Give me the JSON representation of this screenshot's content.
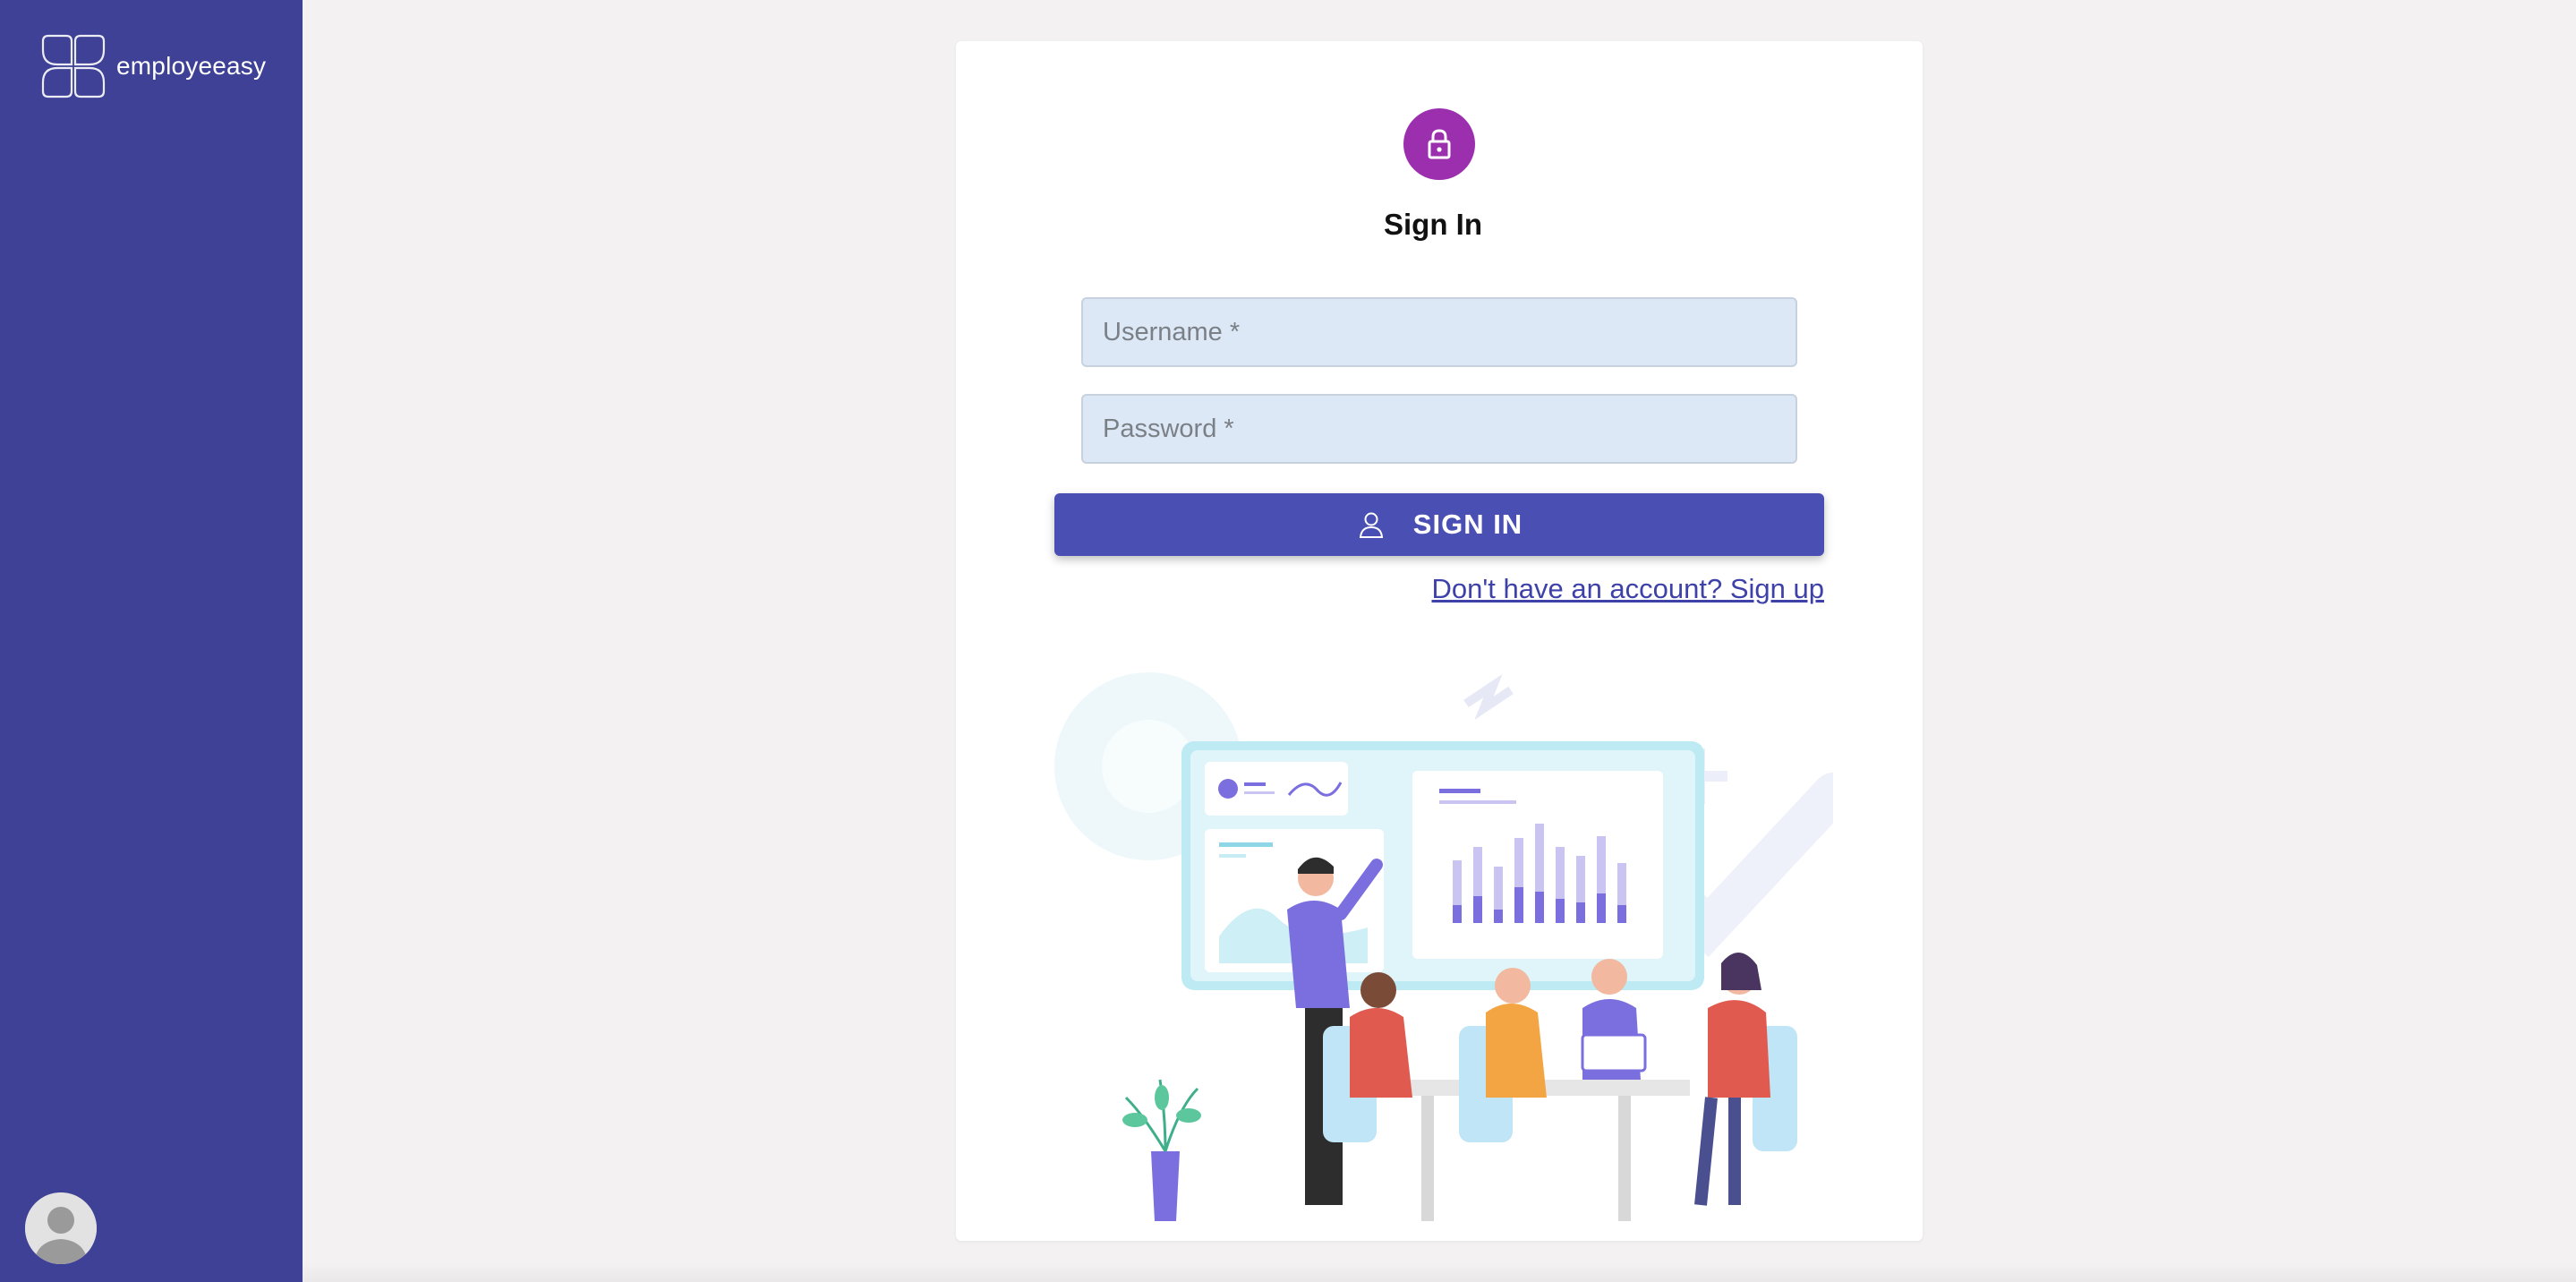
{
  "sidebar": {
    "brand_name": "employeeasy",
    "logo_icon": "petal-logo-icon",
    "avatar_icon": "user-avatar-icon"
  },
  "signin": {
    "lock_icon": "lock-icon",
    "title": "Sign In",
    "username_placeholder": "Username *",
    "password_placeholder": "Password *",
    "button_label": "SIGN IN",
    "button_icon": "person-icon",
    "signup_link": "Don't have an account? Sign up",
    "illustration": "team-meeting-illustration"
  },
  "colors": {
    "sidebar": "#3e4195",
    "page_background": "#f3f1f1",
    "lock_badge": "#9b2fae",
    "button": "#4a4fb4",
    "input_fill": "#dce8f6",
    "link": "#3e41a8"
  }
}
